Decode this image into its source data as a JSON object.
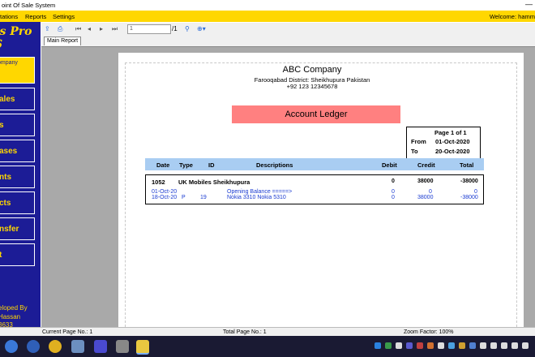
{
  "window": {
    "title": "oint Of Sale System",
    "minimize": "—"
  },
  "menu": {
    "items": [
      "tations",
      "Reports",
      "Settings"
    ],
    "welcome": "Welcome:   hamm"
  },
  "sidebar": {
    "logo_line1": "ts Pro",
    "logo_line2": "S",
    "buttons": [
      "ompany",
      "ales",
      "s",
      "ases",
      "nts",
      "cts",
      "nsfer",
      "t"
    ],
    "developer": [
      "eloped By",
      "Hassan",
      "3633"
    ]
  },
  "toolbar": {
    "page_value": "1",
    "page_total": "/1"
  },
  "tab": {
    "label": "Main Report"
  },
  "report": {
    "company": "ABC Company",
    "address": "Farooqabad District: Sheikhupura Pakistan",
    "phone": "+92 123 12345678",
    "title": "Account Ledger",
    "page_info": "Page 1 of 1",
    "from_label": "From",
    "from_date": "01-Oct-2020",
    "to_label": "To",
    "to_date": "20-Oct-2020",
    "columns": [
      "Date",
      "Type",
      "ID",
      "Descriptions",
      "Debit",
      "Credit",
      "Total"
    ],
    "account": {
      "id": "1052",
      "name": "UK Mobiles Sheikhupura",
      "debit": "0",
      "credit": "38000",
      "total": "-38000"
    },
    "rows": [
      {
        "date": "01-Oct-20",
        "type": "",
        "id": "",
        "description": "Opening Balance =====>",
        "debit": "0",
        "credit": "0",
        "total": "0"
      },
      {
        "date": "18-Oct-20",
        "type": "P",
        "id": "19",
        "description": "Nokia 3310 Nokia 5310",
        "debit": "0",
        "credit": "38000",
        "total": "-38000"
      }
    ]
  },
  "status": {
    "current": "Current Page No.: 1",
    "total": "Total Page No.: 1",
    "zoom": "Zoom Factor: 100%"
  },
  "colors": {
    "sidebar": "#1c1c96",
    "accent": "#ffd700",
    "ledger_title": "#ff8080",
    "header_row": "#a9cdf2",
    "detail_text": "#1a3bd1"
  }
}
